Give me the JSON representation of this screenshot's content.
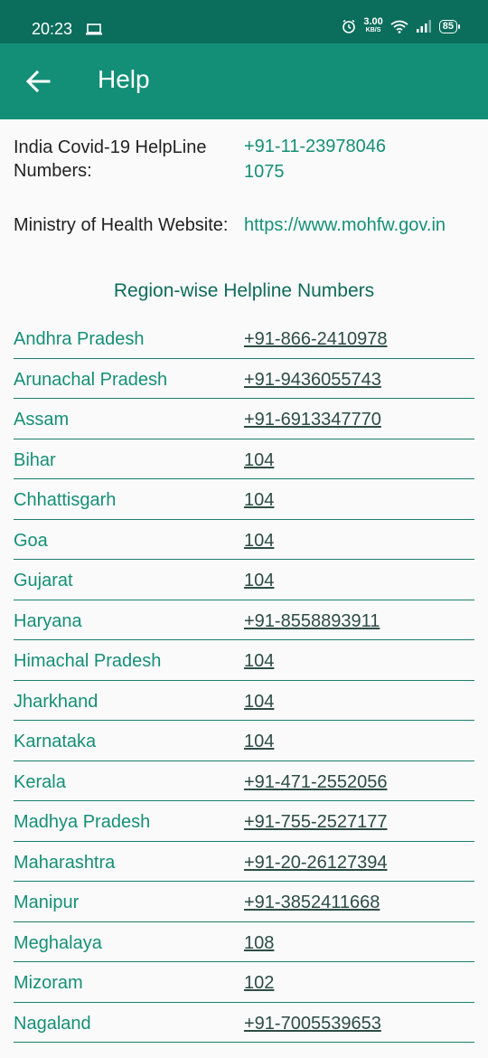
{
  "status_bar": {
    "time": "20:23",
    "speed_value": "3.00",
    "speed_unit": "KB/S",
    "battery": "85"
  },
  "app_bar": {
    "title": "Help",
    "back_icon": "arrow-left-icon"
  },
  "info": {
    "helpline_label": "India Covid-19 HelpLine Numbers:",
    "helpline_number_1": "+91-11-23978046",
    "helpline_number_2": "1075",
    "website_label": "Ministry of Health Website:",
    "website_url": "https://www.mohfw.gov.in"
  },
  "section_title": "Region-wise Helpline Numbers",
  "regions": [
    {
      "name": "Andhra Pradesh",
      "phone": "+91-866-2410978"
    },
    {
      "name": "Arunachal Pradesh",
      "phone": "+91-9436055743"
    },
    {
      "name": "Assam",
      "phone": "+91-6913347770"
    },
    {
      "name": "Bihar",
      "phone": "104"
    },
    {
      "name": "Chhattisgarh",
      "phone": "104"
    },
    {
      "name": "Goa",
      "phone": "104"
    },
    {
      "name": "Gujarat",
      "phone": "104"
    },
    {
      "name": "Haryana",
      "phone": "+91-8558893911"
    },
    {
      "name": "Himachal Pradesh",
      "phone": "104"
    },
    {
      "name": "Jharkhand",
      "phone": "104"
    },
    {
      "name": "Karnataka",
      "phone": "104"
    },
    {
      "name": "Kerala",
      "phone": "+91-471-2552056"
    },
    {
      "name": "Madhya Pradesh",
      "phone": "+91-755-2527177"
    },
    {
      "name": "Maharashtra",
      "phone": "+91-20-26127394"
    },
    {
      "name": "Manipur",
      "phone": "+91-3852411668"
    },
    {
      "name": "Meghalaya",
      "phone": "108"
    },
    {
      "name": "Mizoram",
      "phone": "102"
    },
    {
      "name": "Nagaland",
      "phone": "+91-7005539653"
    }
  ],
  "colors": {
    "status_bar": "#0b6d5c",
    "app_bar": "#148f77",
    "accent_text": "#168f77",
    "divider": "#1b7f6c"
  }
}
